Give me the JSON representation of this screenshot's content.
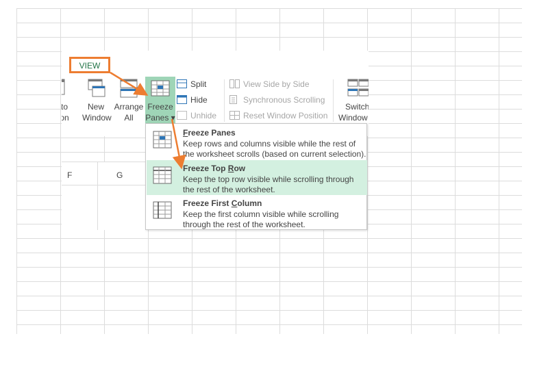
{
  "tab": {
    "label": "VIEW"
  },
  "window_group": {
    "partial_button": {
      "line1": "to",
      "line2": "on"
    },
    "new_window": {
      "line1": "New",
      "line2": "Window"
    },
    "arrange_all": {
      "line1": "Arrange",
      "line2": "All"
    },
    "freeze_panes": {
      "line1": "Freeze",
      "line2": "Panes ▾"
    },
    "split": "Split",
    "hide": "Hide",
    "unhide": "Unhide",
    "view_side_by_side": "View Side by Side",
    "synchronous_scrolling": "Synchronous Scrolling",
    "reset_window_position": "Reset Window Position",
    "switch_windows": {
      "line1": "Switch",
      "line2": "Window"
    }
  },
  "sheet": {
    "columns": [
      "F",
      "G"
    ]
  },
  "menu": {
    "items": [
      {
        "title_key": "F",
        "title_rest": "reeze Panes",
        "description": "Keep rows and columns visible while the rest of the worksheet scrolls (based on current selection).",
        "icon": "freeze-panes-icon"
      },
      {
        "title_pre": "Freeze Top ",
        "title_key": "R",
        "title_rest": "ow",
        "description": "Keep the top row visible while scrolling through the rest of the worksheet.",
        "icon": "freeze-top-row-icon"
      },
      {
        "title_pre": "Freeze First ",
        "title_key": "C",
        "title_rest": "olumn",
        "description": "Keep the first column visible while scrolling through the rest of the worksheet.",
        "icon": "freeze-first-column-icon"
      }
    ]
  },
  "colors": {
    "accent_green": "#217346",
    "highlight": "#9fd5b7",
    "menu_hover": "#d3f0e0",
    "annotation_orange": "#ed7d31",
    "grid": "#dcdcdc"
  }
}
